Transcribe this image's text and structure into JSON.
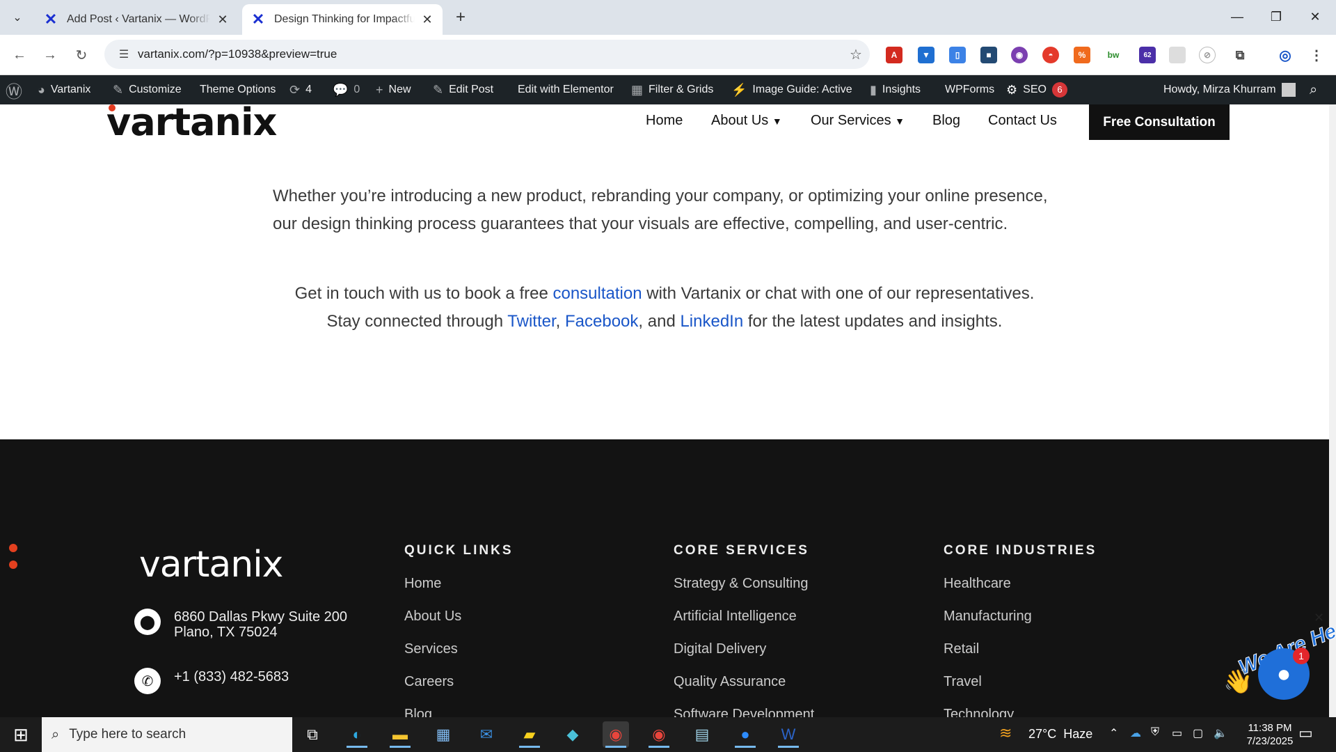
{
  "browser": {
    "tabs": [
      {
        "title": "Add Post ‹ Vartanix — WordPress",
        "active": false
      },
      {
        "title": "Design Thinking for Impactful Visuals",
        "active": true
      }
    ],
    "new_tab_icon": "plus-icon",
    "url": "vartanix.com/?p=10938&preview=true",
    "extension_badge": "62"
  },
  "wpbar": {
    "site": "Vartanix",
    "customize": "Customize",
    "theme_options": "Theme Options",
    "updates": "4",
    "comments": "0",
    "new": "New",
    "edit_post": "Edit Post",
    "edit_elementor": "Edit with Elementor",
    "filter_grids": "Filter & Grids",
    "image_guide": "Image Guide: Active",
    "insights": "Insights",
    "wpforms": "WPForms",
    "seo": "SEO",
    "seo_count": "6",
    "howdy": "Howdy, Mirza Khurram"
  },
  "site": {
    "logo": "vartanix",
    "menu": [
      "Home",
      "About Us",
      "Our Services",
      "Blog",
      "Contact Us"
    ],
    "cta": "Free Consultation"
  },
  "content": {
    "para1": "Whether you’re introducing a new product, rebranding your company, or optimizing your online presence, our design thinking process guarantees that your visuals are effective, compelling, and user-centric.",
    "para2_a": "Get in touch with us to book a free ",
    "para2_link": "consultation",
    "para2_b": " with Vartanix or chat with one of our representatives.",
    "para3_a": "Stay connected through ",
    "twitter": "Twitter",
    "comma": ",",
    "facebook": "Facebook",
    "and": ", and ",
    "linkedin": "LinkedIn",
    "para3_b": " for the latest updates and insights."
  },
  "footer": {
    "logo": "vartanix",
    "address": "6860 Dallas Pkwy Suite 200 Plano, TX 75024",
    "phone": "+1 (833) 482-5683",
    "quick_links": {
      "heading": "QUICK LINKS",
      "items": [
        "Home",
        "About Us",
        "Services",
        "Careers",
        "Blog"
      ]
    },
    "core_services": {
      "heading": "CORE SERVICES",
      "items": [
        "Strategy & Consulting",
        "Artificial Intelligence",
        "Digital Delivery",
        "Quality Assurance",
        "Software Development"
      ]
    },
    "core_industries": {
      "heading": "CORE INDUSTRIES",
      "items": [
        "Healthcare",
        "Manufacturing",
        "Retail",
        "Travel",
        "Technology"
      ]
    }
  },
  "chat": {
    "banner": "We Are Here!",
    "unread": "1"
  },
  "taskbar": {
    "search_placeholder": "Type here to search",
    "weather": "27°C  Haze",
    "time": "11:38 PM",
    "date": "7/23/2025"
  },
  "colors": {
    "accent_blue": "#1a56c8",
    "brand_blue": "#1a2fd1",
    "cta_bg": "#111111",
    "footer_bg": "#131313",
    "wpbar_bg": "#1d2327"
  }
}
